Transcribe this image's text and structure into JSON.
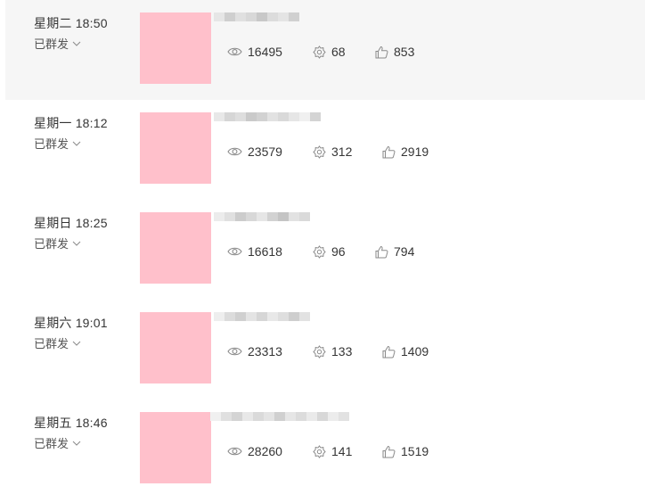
{
  "articles": [
    {
      "time": "星期二 18:50",
      "status": "已群发",
      "views": "16495",
      "shares": "68",
      "likes": "853"
    },
    {
      "time": "星期一 18:12",
      "status": "已群发",
      "views": "23579",
      "shares": "312",
      "likes": "2919"
    },
    {
      "time": "星期日 18:25",
      "status": "已群发",
      "views": "16618",
      "shares": "96",
      "likes": "794"
    },
    {
      "time": "星期六 19:01",
      "status": "已群发",
      "views": "23313",
      "shares": "133",
      "likes": "1409"
    },
    {
      "time": "星期五 18:46",
      "status": "已群发",
      "views": "28260",
      "shares": "141",
      "likes": "1519"
    }
  ],
  "colors": {
    "thumbnail": "#ffc0cb",
    "hover_row": "#f6f6f6",
    "icon": "#8a8a8a"
  },
  "icons": {
    "views": "eye-icon",
    "shares": "share-gear-icon",
    "likes": "thumbs-up-icon",
    "status_dropdown": "chevron-down-icon"
  }
}
